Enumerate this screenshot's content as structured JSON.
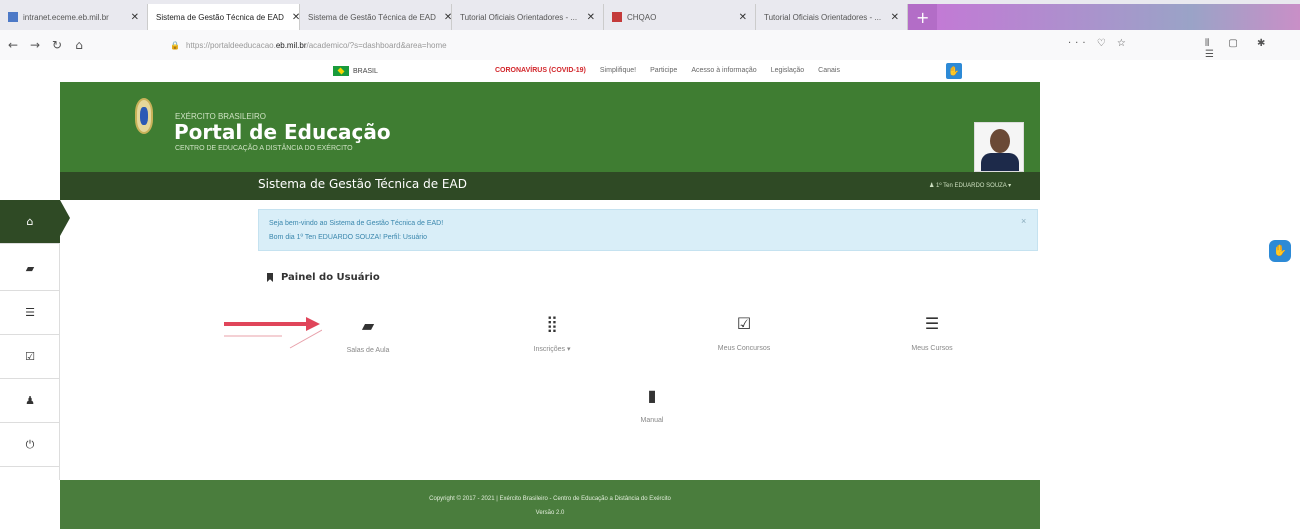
{
  "browser": {
    "tabs": [
      {
        "label": "intranet.eceme.eb.mil.br",
        "close": "✕"
      },
      {
        "label": "Sistema de Gestão Técnica de EAD",
        "close": "✕"
      },
      {
        "label": "Sistema de Gestão Técnica de EAD",
        "close": "✕"
      },
      {
        "label": "Tutorial Oficiais Orientadores - ...",
        "close": "✕"
      },
      {
        "label": "CHQAO",
        "close": "✕"
      },
      {
        "label": "Tutorial Oficiais Orientadores - ...",
        "close": "✕"
      }
    ],
    "new_tab": "+",
    "url_prefix": "https://portaldeeducacao.",
    "url_domain": "eb.mil.br",
    "url_suffix": "/academico/?s=dashboard&area=home",
    "url_actions": "··· ♡ ☆",
    "toolbar_right": "⫴ ▢ ✱ ☰"
  },
  "gov_bar": {
    "brasil": "BRASIL",
    "links": [
      "CORONAVÍRUS (COVID-19)",
      "Simplifique!",
      "Participe",
      "Acesso à informação",
      "Legislação",
      "Canais"
    ]
  },
  "header": {
    "org": "EXÉRCITO BRASILEIRO",
    "title": "Portal de Educação",
    "subtitle": "CENTRO DE EDUCAÇÃO A DISTÂNCIA DO EXÉRCITO",
    "system_title": "Sistema de Gestão Técnica de EAD",
    "user": "1º Ten EDUARDO SOUZA ▾"
  },
  "sidebar": {
    "items": [
      {
        "icon": "home-icon",
        "glyph": "⌂"
      },
      {
        "icon": "book-icon",
        "glyph": "▰"
      },
      {
        "icon": "list-icon",
        "glyph": "☰"
      },
      {
        "icon": "checkbox-icon",
        "glyph": "☑"
      },
      {
        "icon": "user-icon",
        "glyph": "♟"
      },
      {
        "icon": "power-icon",
        "glyph": "⏻"
      }
    ]
  },
  "alert": {
    "line1": "Seja bem-vindo ao Sistema de Gestão Técnica de EAD!",
    "line2": "Bom dia 1º Ten EDUARDO SOUZA! Perfil: Usuário",
    "close": "×"
  },
  "panel": {
    "title": "Painel do Usuário",
    "tiles": [
      {
        "label": "Salas de Aula",
        "glyph": "▰"
      },
      {
        "label": "Inscrições ▾",
        "glyph": "⣿"
      },
      {
        "label": "Meus Concursos",
        "glyph": "☑"
      },
      {
        "label": "Meus Cursos",
        "glyph": "☰"
      },
      {
        "label": "Manual",
        "glyph": "▮"
      }
    ]
  },
  "footer": {
    "line1": "Copyright © 2017 - 2021 | Exército Brasileiro - Centro de Educação a Distância do Exército",
    "line2": "Versão 2.0"
  },
  "colors": {
    "header_green": "#3f7d32",
    "dark_green": "#2f4a25",
    "footer_green": "#4a7d3d",
    "alert_bg": "#d9eef8",
    "arrow_red": "#e0455a"
  }
}
